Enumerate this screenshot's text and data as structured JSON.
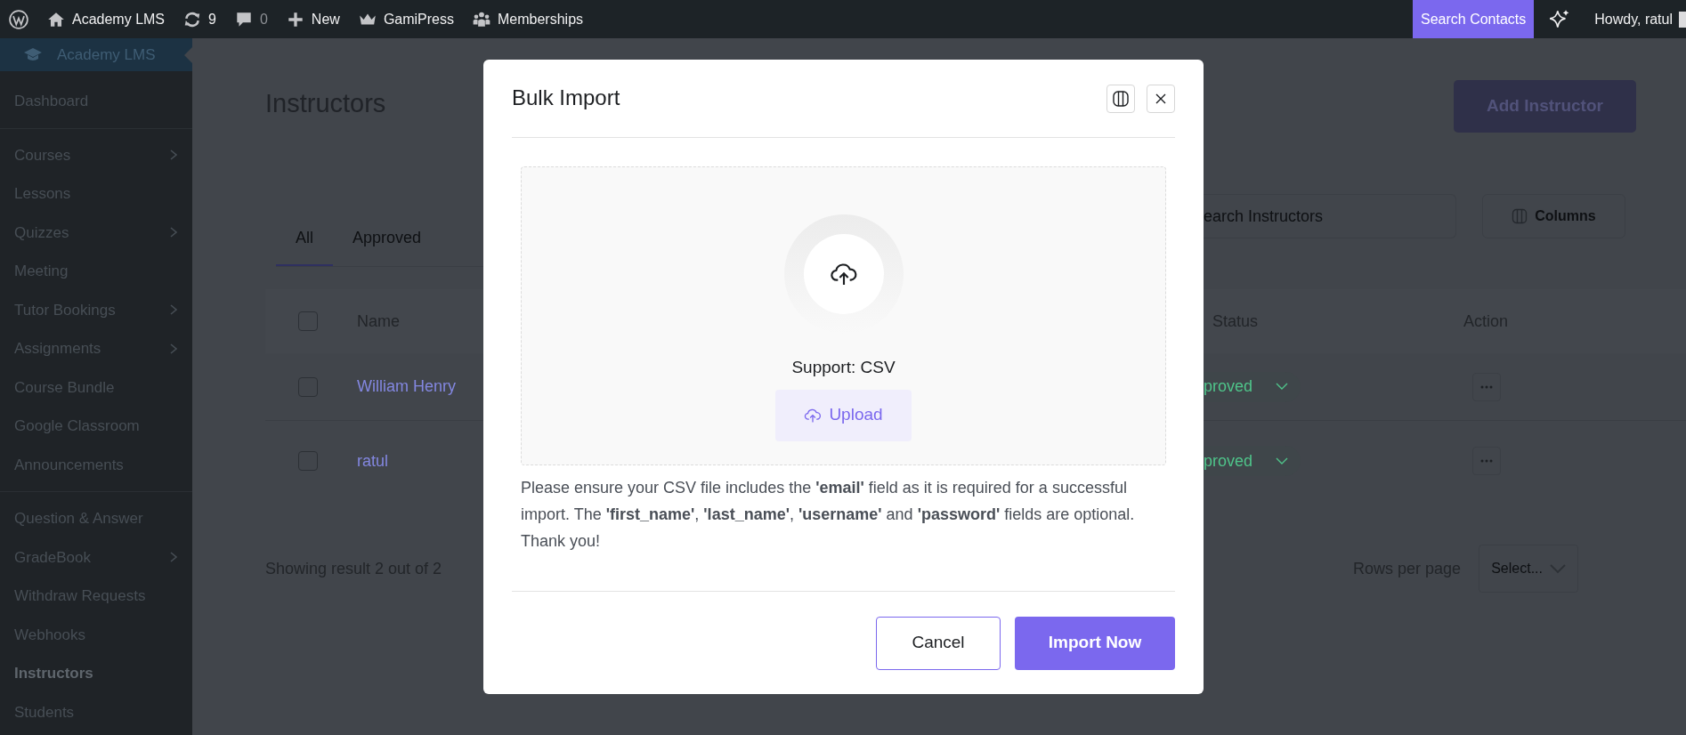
{
  "admin_bar": {
    "items": [
      {
        "kind": "logo"
      },
      {
        "kind": "home",
        "label": "Academy LMS"
      },
      {
        "kind": "updates",
        "label": "9"
      },
      {
        "kind": "comments",
        "label": "0"
      },
      {
        "kind": "new",
        "label": "New"
      },
      {
        "kind": "crown",
        "label": "GamiPress"
      },
      {
        "kind": "members",
        "label": "Memberships"
      }
    ],
    "search_contacts": "Search Contacts",
    "greeting": "Howdy, ratul"
  },
  "sidebar": {
    "header": "Academy LMS",
    "groups": [
      [
        {
          "label": "Dashboard",
          "has_submenu": false,
          "selected": false
        }
      ],
      [
        {
          "label": "Courses",
          "has_submenu": true,
          "selected": false
        },
        {
          "label": "Lessons",
          "has_submenu": false,
          "selected": false
        },
        {
          "label": "Quizzes",
          "has_submenu": true,
          "selected": false
        },
        {
          "label": "Meeting",
          "has_submenu": false,
          "selected": false
        },
        {
          "label": "Tutor Bookings",
          "has_submenu": true,
          "selected": false
        },
        {
          "label": "Assignments",
          "has_submenu": true,
          "selected": false
        },
        {
          "label": "Course Bundle",
          "has_submenu": false,
          "selected": false
        },
        {
          "label": "Google Classroom",
          "has_submenu": false,
          "selected": false
        },
        {
          "label": "Announcements",
          "has_submenu": false,
          "selected": false
        }
      ],
      [
        {
          "label": "Question & Answer",
          "has_submenu": false,
          "selected": false
        },
        {
          "label": "GradeBook",
          "has_submenu": true,
          "selected": false
        },
        {
          "label": "Withdraw Requests",
          "has_submenu": false,
          "selected": false
        },
        {
          "label": "Webhooks",
          "has_submenu": false,
          "selected": false
        },
        {
          "label": "Instructors",
          "has_submenu": false,
          "selected": true
        },
        {
          "label": "Students",
          "has_submenu": false,
          "selected": false
        }
      ]
    ]
  },
  "page": {
    "title": "Instructors",
    "add_button": "Add Instructor",
    "tabs": [
      {
        "label": "All",
        "selected": true
      },
      {
        "label": "Approved",
        "selected": false
      }
    ],
    "search": {
      "placeholder": "earch Instructors"
    },
    "columns_button": "Columns",
    "table": {
      "columns": [
        "Name",
        "Status",
        "Action"
      ],
      "header_checked": false,
      "rows": [
        {
          "checked": false,
          "name": "William Henry",
          "status": "proved"
        },
        {
          "checked": false,
          "name": "ratul",
          "status": "proved"
        }
      ]
    },
    "footer": {
      "showing": "Showing result 2 out of 2",
      "rows_per_page": "Rows per page",
      "select": "Select..."
    }
  },
  "modal": {
    "title": "Bulk Import",
    "support": "Support: CSV",
    "upload": "Upload",
    "note": "Please ensure your CSV file includes the **'email'** field as it is required for a successful import. The **'first_name'**, **'last_name'**, **'username'** and **'password'** fields are optional. Thank you!",
    "cancel": "Cancel",
    "submit": "Import Now"
  }
}
